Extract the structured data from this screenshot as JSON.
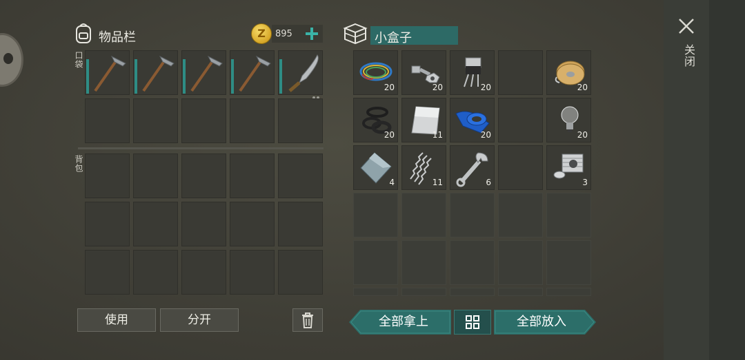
{
  "inventory": {
    "title": "物品栏",
    "currency": "895",
    "pocket_label": "口袋",
    "backpack_label": "背包",
    "pocket_row1": [
      {
        "icon": "pickaxe-icon",
        "has_bar": true
      },
      {
        "icon": "pickaxe-icon",
        "has_bar": true
      },
      {
        "icon": "pickaxe-icon",
        "has_bar": true
      },
      {
        "icon": "pickaxe-icon",
        "has_bar": true
      },
      {
        "icon": "machete-icon",
        "has_bar": true,
        "dots": true
      }
    ],
    "use_button": "使用",
    "split_button": "分开"
  },
  "container": {
    "title": "小盒子",
    "items": [
      {
        "icon": "wire-bundle-icon",
        "count": "20"
      },
      {
        "icon": "bolt-nut-icon",
        "count": "20"
      },
      {
        "icon": "transistor-icon",
        "count": "20"
      },
      {
        "icon": "",
        "count": ""
      },
      {
        "icon": "cable-spool-icon",
        "count": "20"
      },
      {
        "icon": "rubber-rings-icon",
        "count": "20"
      },
      {
        "icon": "metal-sheet-icon",
        "count": "11"
      },
      {
        "icon": "blue-tape-icon",
        "count": "20"
      },
      {
        "icon": "",
        "count": ""
      },
      {
        "icon": "light-bulb-icon",
        "count": "20"
      },
      {
        "icon": "metal-plate-icon",
        "count": "4"
      },
      {
        "icon": "spring-icon",
        "count": "11"
      },
      {
        "icon": "wrench-icon",
        "count": "6"
      },
      {
        "icon": "",
        "count": ""
      },
      {
        "icon": "engine-cylinder-icon",
        "count": "3"
      }
    ],
    "take_all_button": "全部拿上",
    "put_all_button": "全部放入"
  },
  "close_label": "关闭",
  "colors": {
    "teal": "#2c6e69",
    "accent_teal": "#3ab3a7",
    "count_text": "#f0efe8"
  }
}
